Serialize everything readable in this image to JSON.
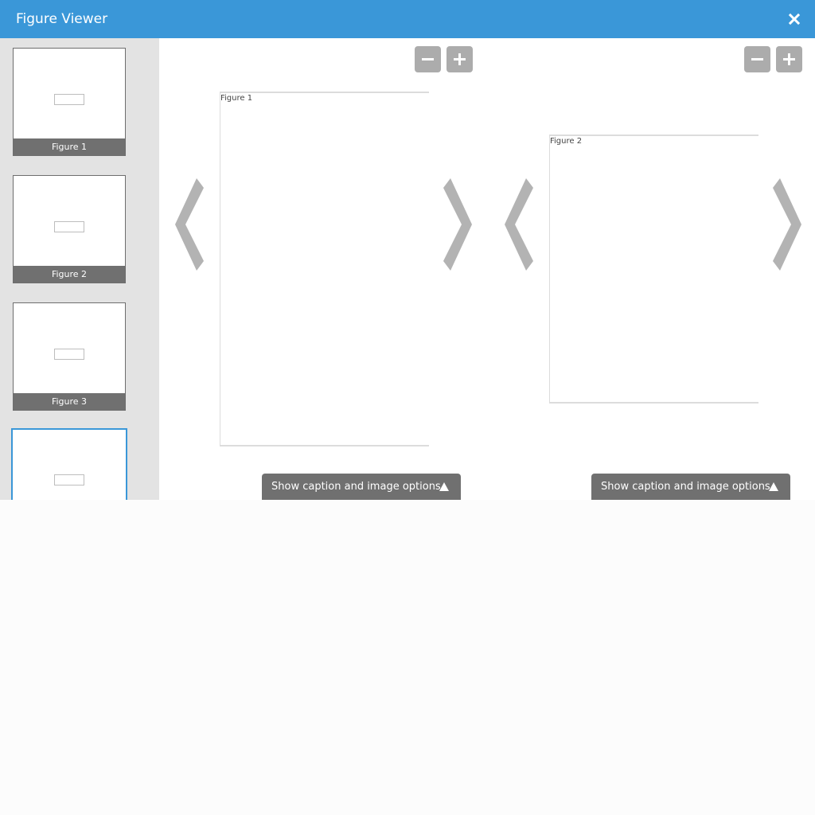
{
  "window": {
    "title": "Figure Viewer"
  },
  "sidebar": {
    "thumbnails": [
      {
        "label": "Figure 1"
      },
      {
        "label": "Figure 2"
      },
      {
        "label": "Figure 3"
      },
      {
        "label": ""
      }
    ]
  },
  "panels": [
    {
      "figure_label": "Figure 1",
      "caption_button": "Show caption and image options"
    },
    {
      "figure_label": "Figure 2",
      "caption_button": "Show caption and image options"
    }
  ],
  "icons": {
    "close": "close-icon",
    "zoom_out": "minus-icon",
    "zoom_in": "plus-icon",
    "prev": "chevron-left-icon",
    "next": "chevron-right-icon",
    "caption_toggle": "triangle-up-icon"
  },
  "colors": {
    "accent": "#3a97d8",
    "button_gray": "#acacac",
    "label_gray": "#707070",
    "sidebar_bg": "#e3e3e3"
  }
}
